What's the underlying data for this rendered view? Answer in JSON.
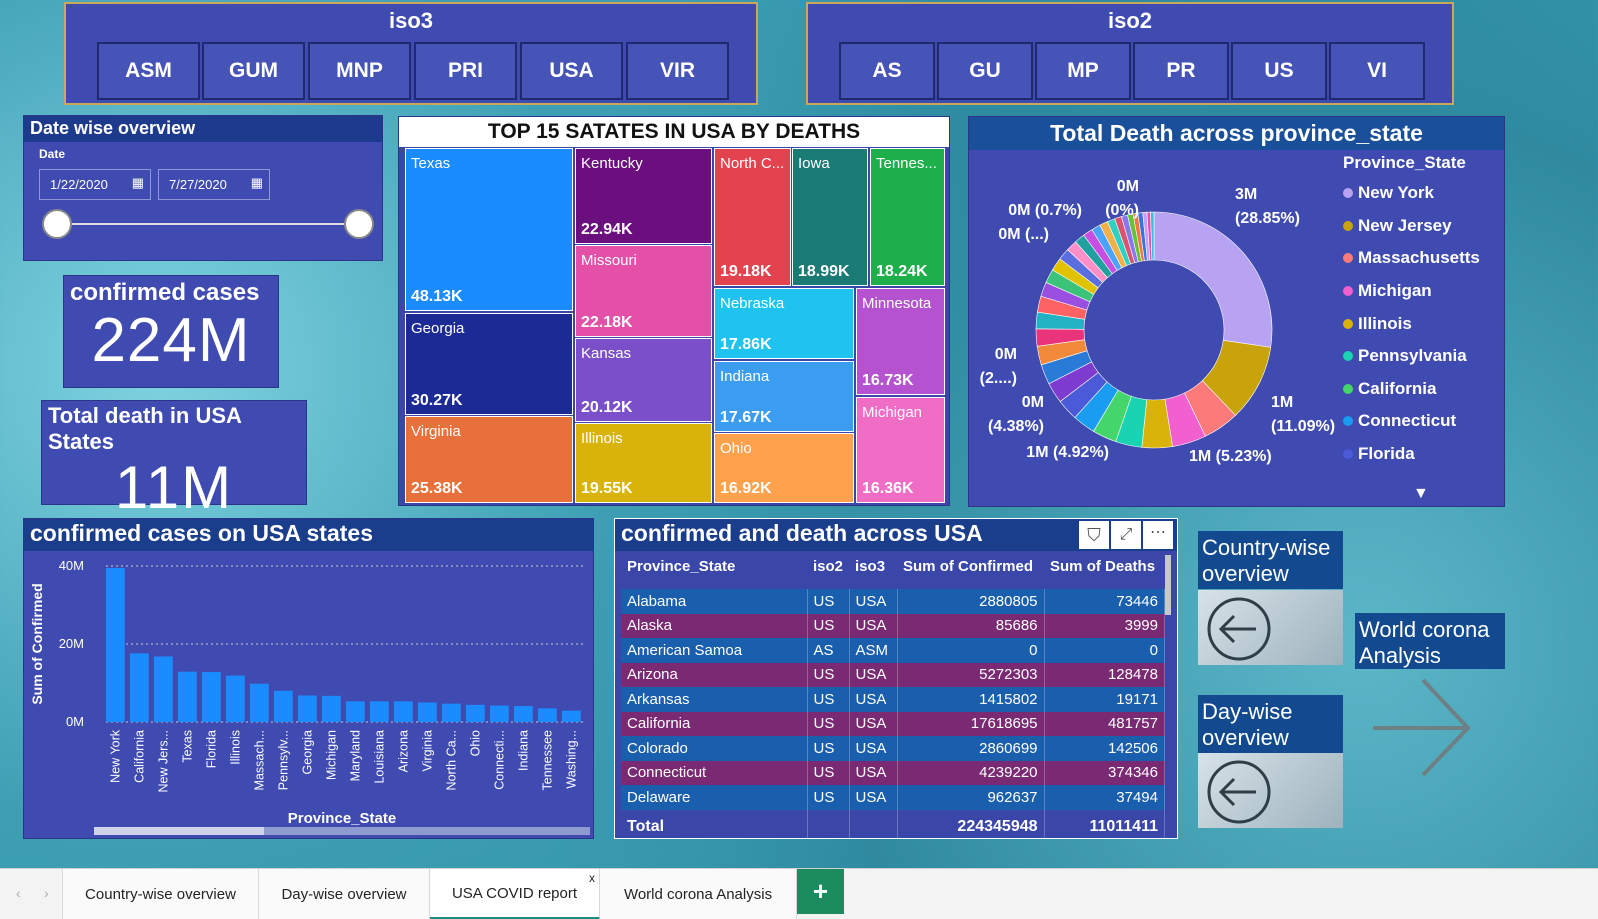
{
  "slicers": {
    "iso3": {
      "title": "iso3",
      "items": [
        "ASM",
        "GUM",
        "MNP",
        "PRI",
        "USA",
        "VIR"
      ]
    },
    "iso2": {
      "title": "iso2",
      "items": [
        "AS",
        "GU",
        "MP",
        "PR",
        "US",
        "VI"
      ]
    }
  },
  "date_overview": {
    "title": "Date wise overview",
    "label": "Date",
    "start": "1/22/2020",
    "end": "7/27/2020"
  },
  "confirmed_card": {
    "title": "confirmed cases",
    "value": "224M"
  },
  "death_card": {
    "title": "Total death in USA States",
    "value": "11M"
  },
  "treemap": {
    "title": "TOP 15 SATATES IN USA BY DEATHS",
    "cells": [
      {
        "name": "Texas",
        "value": "48.13K",
        "color": "#1a8cff"
      },
      {
        "name": "Georgia",
        "value": "30.27K",
        "color": "#1b2a94"
      },
      {
        "name": "Virginia",
        "value": "25.38K",
        "color": "#e8703a"
      },
      {
        "name": "Kentucky",
        "value": "22.94K",
        "color": "#6b0f7e"
      },
      {
        "name": "Missouri",
        "value": "22.18K",
        "color": "#e44fa8"
      },
      {
        "name": "Kansas",
        "value": "20.12K",
        "color": "#7b4fc9"
      },
      {
        "name": "Illinois",
        "value": "19.55K",
        "color": "#d9b20a"
      },
      {
        "name": "North C...",
        "value": "19.18K",
        "color": "#e3434f"
      },
      {
        "name": "Iowa",
        "value": "18.99K",
        "color": "#1a7a74"
      },
      {
        "name": "Tennes...",
        "value": "18.24K",
        "color": "#1db04a"
      },
      {
        "name": "Nebraska",
        "value": "17.86K",
        "color": "#1ec4ef"
      },
      {
        "name": "Indiana",
        "value": "17.67K",
        "color": "#3b9cf0"
      },
      {
        "name": "Ohio",
        "value": "16.92K",
        "color": "#ffa14d"
      },
      {
        "name": "Minnesota",
        "value": "16.73K",
        "color": "#b552cf"
      },
      {
        "name": "Michigan",
        "value": "16.36K",
        "color": "#f06dc6"
      }
    ]
  },
  "donut": {
    "title": "Total Death across province_state",
    "legend_title": "Province_State",
    "legend": [
      {
        "name": "New York",
        "color": "#b7a3f2"
      },
      {
        "name": "New Jersey",
        "color": "#c9a30c"
      },
      {
        "name": "Massachusetts",
        "color": "#fd7a7a"
      },
      {
        "name": "Michigan",
        "color": "#f25fce"
      },
      {
        "name": "Illinois",
        "color": "#d9b20a"
      },
      {
        "name": "Pennsylvania",
        "color": "#19d3b2"
      },
      {
        "name": "California",
        "color": "#44d66a"
      },
      {
        "name": "Connecticut",
        "color": "#1a9cf0"
      },
      {
        "name": "Florida",
        "color": "#4a5ad8"
      }
    ],
    "labels": {
      "ny": "3M",
      "ny_pct": "(28.85%)",
      "nj": "1M",
      "nj_pct": "(11.09%)",
      "ma": "1M (5.23%)",
      "mi": "1M (4.92%)",
      "il": "0M",
      "il_pct": "(4.38%)",
      "pa": "0M",
      "pa_pct": "(2....)",
      "a": "0M (...)",
      "b": "0M (0.7%)",
      "c": "0M",
      "c_pct": "(0%)"
    }
  },
  "chart_data": {
    "type": "bar",
    "title": "confirmed cases on USA states",
    "xlabel": "Province_State",
    "ylabel": "Sum of Confirmed",
    "ylim": [
      0,
      40000000
    ],
    "yticks": [
      "40M",
      "20M",
      "0M"
    ],
    "categories": [
      "New York",
      "California",
      "New Jers...",
      "Texas",
      "Florida",
      "Illinois",
      "Massach...",
      "Pennsylv...",
      "Georgia",
      "Michigan",
      "Maryland",
      "Louisiana",
      "Arizona",
      "Virginia",
      "North Ca...",
      "Ohio",
      "Connecti...",
      "Indiana",
      "Tennessee",
      "Washing..."
    ],
    "values": [
      39500000,
      17600000,
      16800000,
      12900000,
      12800000,
      11900000,
      9800000,
      8000000,
      6800000,
      6700000,
      5300000,
      5300000,
      5300000,
      5000000,
      4700000,
      4400000,
      4200000,
      4100000,
      3500000,
      2900000
    ],
    "bar_color": "#1a8cff"
  },
  "table": {
    "title": "confirmed and death across USA",
    "columns": [
      "Province_State",
      "iso2",
      "iso3",
      "Sum of Confirmed",
      "Sum of Deaths"
    ],
    "rows": [
      [
        "Alabama",
        "US",
        "USA",
        "2880805",
        "73446"
      ],
      [
        "Alaska",
        "US",
        "USA",
        "85686",
        "3999"
      ],
      [
        "American Samoa",
        "AS",
        "ASM",
        "0",
        "0"
      ],
      [
        "Arizona",
        "US",
        "USA",
        "5272303",
        "128478"
      ],
      [
        "Arkansas",
        "US",
        "USA",
        "1415802",
        "19171"
      ],
      [
        "California",
        "US",
        "USA",
        "17618695",
        "481757"
      ],
      [
        "Colorado",
        "US",
        "USA",
        "2860699",
        "142506"
      ],
      [
        "Connecticut",
        "US",
        "USA",
        "4239220",
        "374346"
      ],
      [
        "Delaware",
        "US",
        "USA",
        "962637",
        "37494"
      ]
    ],
    "total": [
      "Total",
      "",
      "",
      "224345948",
      "11011411"
    ]
  },
  "nav": {
    "country": "Country-wise overview",
    "day": "Day-wise overview",
    "world": "World corona Analysis"
  },
  "tabs": [
    {
      "label": "Country-wise overview"
    },
    {
      "label": "Day-wise overview"
    },
    {
      "label": "USA COVID report",
      "active": true
    },
    {
      "label": "World corona Analysis"
    }
  ]
}
